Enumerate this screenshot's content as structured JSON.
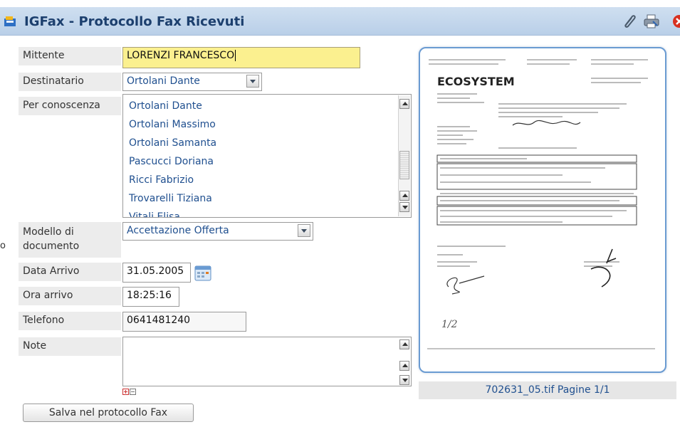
{
  "window": {
    "title": "IGFax - Protocollo Fax Ricevuti"
  },
  "toolbar": {
    "icons": [
      "paperclip-icon",
      "print-icon",
      "close-icon"
    ]
  },
  "form": {
    "mittente": {
      "label": "Mittente",
      "value": "LORENZI FRANCESCO"
    },
    "destinatario": {
      "label": "Destinatario",
      "value": "Ortolani Dante"
    },
    "per_conoscenza": {
      "label": "Per conoscenza",
      "options": [
        "Ortolani Dante",
        "Ortolani Massimo",
        "Ortolani Samanta",
        "Pascucci Doriana",
        "Ricci Fabrizio",
        "Trovarelli Tiziana",
        "Vitali Elisa"
      ]
    },
    "modello": {
      "label_line1": "Modello di",
      "label_line2": "documento",
      "value": "Accettazione Offerta"
    },
    "data_arrivo": {
      "label": "Data Arrivo",
      "value": "31.05.2005"
    },
    "ora_arrivo": {
      "label": "Ora arrivo",
      "value": "18:25:16"
    },
    "telefono": {
      "label": "Telefono",
      "value": "0641481240"
    },
    "note": {
      "label": "Note",
      "value": ""
    },
    "save_label": "Salva nel protocollo Fax"
  },
  "left_edge_fragment": "o",
  "preview": {
    "caption": "702631_05.tif Pagine 1/1",
    "logo_text": "ECOSYSTEM",
    "page_mark": "1/2"
  },
  "colors": {
    "accent": "#6a9bd2",
    "title": "#1c3f6e",
    "highlight_field": "#fbf08f",
    "select_text": "#1f4f8f"
  }
}
